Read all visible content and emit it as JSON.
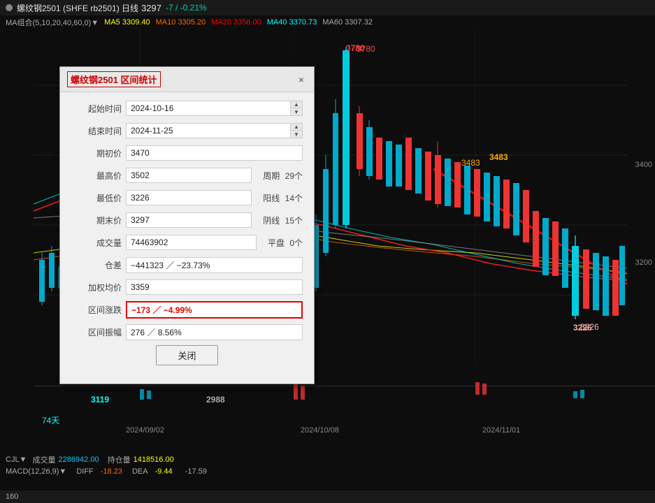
{
  "window": {
    "title": "螺纹钢2501 (SHFE rb2501) 日线",
    "price": "3297",
    "change": "-7 / -0.21%"
  },
  "ma_bar": {
    "label": "MA组合(5,10,20,40,60,0)▼",
    "ma5_label": "MA5",
    "ma5_val": "3309.40",
    "ma10_label": "MA10",
    "ma10_val": "3305.20",
    "ma20_label": "MA20",
    "ma20_val": "3356.00",
    "ma40_label": "MA40",
    "ma40_val": "3370.73",
    "ma60_label": "MA60",
    "ma60_val": "3307.32"
  },
  "dialog": {
    "title": "螺纹钢2501 区间统计",
    "close_icon": "×",
    "start_time_label": "起始时间",
    "start_time_value": "2024-10-16",
    "end_time_label": "结束时间",
    "end_time_value": "2024-11-25",
    "qichujia_label": "期初价",
    "qichujia_value": "3470",
    "zuigaojia_label": "最高价",
    "zuigaojia_value": "3502",
    "zuidiijia_label": "最低价",
    "zuidiijia_value": "3226",
    "qimojia_label": "期末价",
    "qimojia_value": "3297",
    "chengjiaoliang_label": "成交量",
    "chengjiaoliang_value": "74463902",
    "cangcha_label": "仓差",
    "cangcha_value": "−441323 ／ −23.73%",
    "jiaquan_label": "加权均价",
    "jiaquan_value": "3359",
    "zhangjie_label": "区间涨跌",
    "zhangjie_value": "−173 ／ −4.99%",
    "zhenfu_label": "区间振幅",
    "zhenfu_value": "276 ／ 8.56%",
    "zhouqi_label": "周期",
    "zhouqi_value": "29个",
    "yangxian_label": "阳线",
    "yangxian_value": "14个",
    "yinxian_label": "阴线",
    "yinxian_value": "15个",
    "pingpan_label": "平盘",
    "pingpan_value": "0个",
    "close_btn_label": "关闭"
  },
  "chart": {
    "annotations": {
      "price_3780": "3780",
      "price_3483": "3483",
      "price_3226": "3226",
      "price_3119": "3119",
      "price_2988": "2988"
    },
    "day_count": "74天",
    "axis_prices": [
      "3400",
      "3200"
    ],
    "date_labels": [
      "2024/09/02",
      "2024/10/08",
      "2024/11/01"
    ]
  },
  "bottom": {
    "cjl_label": "CJL▼",
    "chengjiao_label": "成交量",
    "chengjiao_value": "2286942.00",
    "chichang_label": "持仓量",
    "chichang_value": "1418516.00",
    "macd_label": "MACD(12,26,9)▼",
    "diff_label": "DIFF",
    "diff_value": "-18.23",
    "dea_label": "DEA",
    "dea_value": "-9.44",
    "macd_val": "-17.59"
  }
}
